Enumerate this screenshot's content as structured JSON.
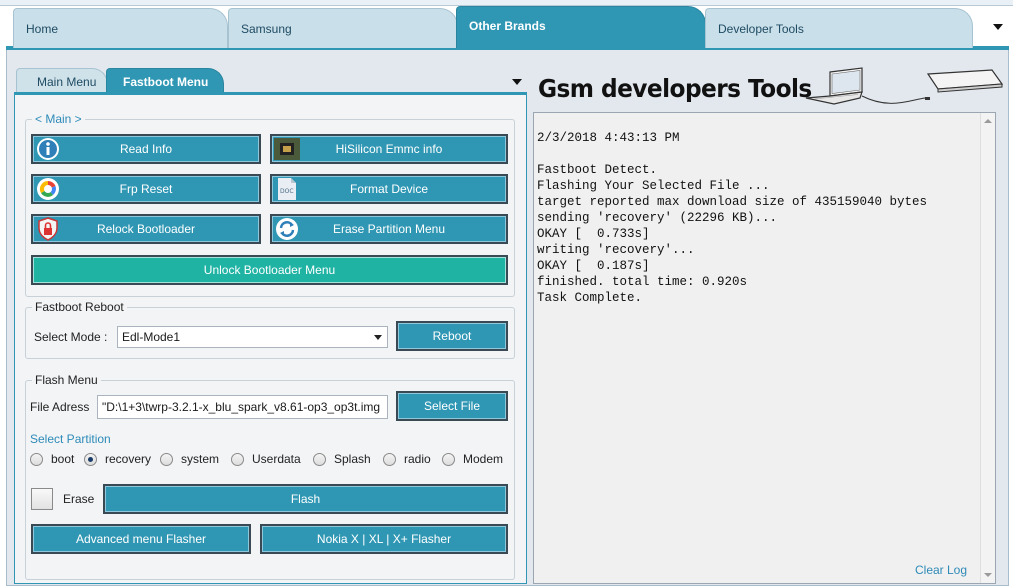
{
  "colors": {
    "accent": "#2f97b4",
    "unlock_button": "#1fb3a4",
    "link": "#2e8bb8"
  },
  "top_tabs": [
    {
      "label": "Home",
      "active": false
    },
    {
      "label": "Samsung",
      "active": false
    },
    {
      "label": "Other Brands",
      "active": true
    },
    {
      "label": "Developer Tools",
      "active": false
    }
  ],
  "sub_tabs": [
    {
      "label": "Main Menu",
      "active": false
    },
    {
      "label": "Fastboot Menu",
      "active": true
    }
  ],
  "main_group": {
    "title": "< Main >",
    "buttons": {
      "read_info": {
        "label": "Read Info",
        "icon": "info-icon"
      },
      "hisilicon": {
        "label": "HiSilicon Emmc info",
        "icon": "chip-icon"
      },
      "frp_reset": {
        "label": "Frp Reset",
        "icon": "google-icon"
      },
      "format_device": {
        "label": "Format Device",
        "icon": "doc-icon"
      },
      "relock": {
        "label": "Relock Bootloader",
        "icon": "lock-shield-icon"
      },
      "erase_partition": {
        "label": "Erase Partition Menu",
        "icon": "refresh-icon"
      },
      "unlock": {
        "label": "Unlock Bootloader Menu"
      }
    }
  },
  "fastboot_reboot": {
    "title": "Fastboot Reboot",
    "select_label": "Select Mode :",
    "select_value": "Edl-Mode1",
    "reboot_label": "Reboot"
  },
  "flash_menu": {
    "title": "Flash Menu",
    "file_label": "File Adress",
    "file_value": "\"D:\\1+3\\twrp-3.2.1-x_blu_spark_v8.61-op3_op3t.img",
    "select_file_label": "Select File",
    "partition_label": "Select Partition",
    "partitions": [
      {
        "label": "boot",
        "checked": false
      },
      {
        "label": "recovery",
        "checked": true
      },
      {
        "label": "system",
        "checked": false
      },
      {
        "label": "Userdata",
        "checked": false
      },
      {
        "label": "Splash",
        "checked": false
      },
      {
        "label": "radio",
        "checked": false
      },
      {
        "label": "Modem",
        "checked": false
      }
    ],
    "erase_label": "Erase",
    "erase_checked": false,
    "flash_label": "Flash",
    "advanced_label": "Advanced menu Flasher",
    "nokia_label": "Nokia X | XL | X+ Flasher"
  },
  "brand_title": "Gsm developers Tools",
  "log": {
    "lines": [
      "2/3/2018 4:43:13 PM",
      "",
      "Fastboot Detect.",
      "Flashing Your Selected File ...",
      "target reported max download size of 435159040 bytes",
      "sending 'recovery' (22296 KB)...",
      "OKAY [  0.733s]",
      "writing 'recovery'...",
      "OKAY [  0.187s]",
      "finished. total time: 0.920s",
      "Task Complete."
    ],
    "clear_label": "Clear Log"
  }
}
